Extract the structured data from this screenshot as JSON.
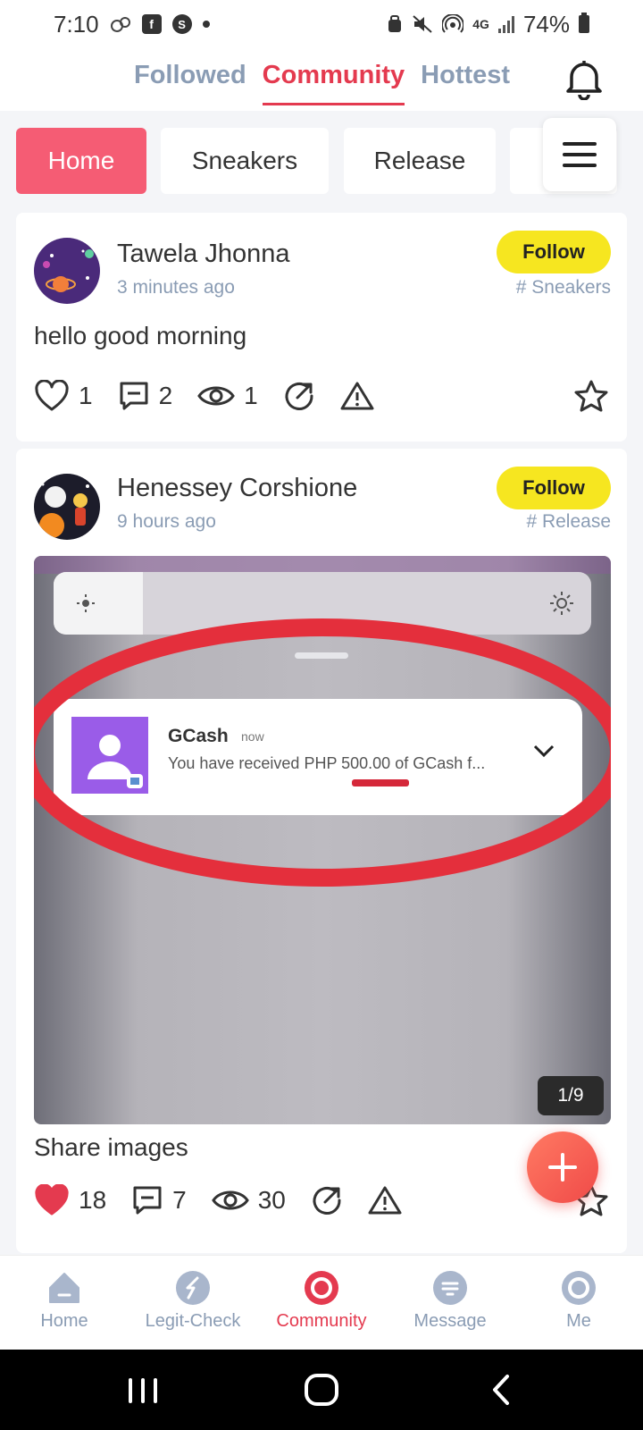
{
  "status_bar": {
    "time": "7:10",
    "network": "4G",
    "battery": "74%"
  },
  "top_tabs": [
    {
      "label": "Followed",
      "active": false
    },
    {
      "label": "Community",
      "active": true
    },
    {
      "label": "Hottest",
      "active": false
    }
  ],
  "categories": [
    "Home",
    "Sneakers",
    "Release"
  ],
  "posts": [
    {
      "author": "Tawela Jhonna",
      "time": "3 minutes ago",
      "follow_label": "Follow",
      "tag": "# Sneakers",
      "text": "hello good morning",
      "likes": "1",
      "comments": "2",
      "views": "1",
      "liked": false
    },
    {
      "author": "Henessey Corshione",
      "time": "9 hours ago",
      "follow_label": "Follow",
      "tag": "# Release",
      "image": {
        "notif_app": "GCash",
        "notif_time": "now",
        "notif_message": "You have received PHP 500.00 of GCash f...",
        "counter": "1/9"
      },
      "text": "Share images",
      "likes": "18",
      "comments": "7",
      "views": "30",
      "liked": true
    }
  ],
  "bottom_nav": [
    {
      "label": "Home",
      "icon": "home-icon"
    },
    {
      "label": "Legit-Check",
      "icon": "legit-check-icon"
    },
    {
      "label": "Community",
      "icon": "community-icon",
      "active": true
    },
    {
      "label": "Message",
      "icon": "message-icon"
    },
    {
      "label": "Me",
      "icon": "me-icon"
    }
  ],
  "colors": {
    "accent": "#e43a4f",
    "chip_active": "#f55c74",
    "follow": "#f6e620",
    "muted": "#8a9cb4"
  }
}
